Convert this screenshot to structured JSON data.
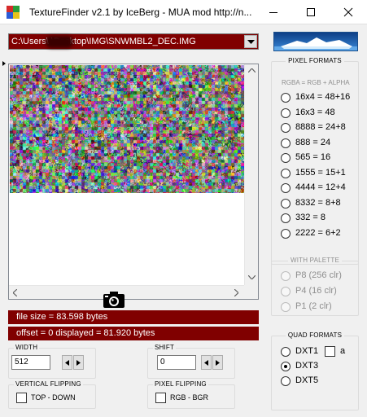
{
  "window": {
    "title": "TextureFinder v2.1 by IceBerg - MUA mod http://n..."
  },
  "file_path": "C:\\Users\\     \\Desktop\\IMG\\SNWMBL2_DEC.IMG",
  "info": {
    "file_size": "file size = 83.598 bytes",
    "offset_displayed": "offset = 0   displayed = 81.920 bytes"
  },
  "width_group": {
    "label": "WIDTH",
    "value": "512"
  },
  "shift_group": {
    "label": "SHIFT",
    "value": "0"
  },
  "vertical_flipping": {
    "label": "VERTICAL FLIPPING",
    "option": "TOP - DOWN",
    "checked": false
  },
  "pixel_flipping": {
    "label": "PIXEL FLIPPING",
    "option": "RGB  -  BGR",
    "checked": false
  },
  "pixel_formats": {
    "label": "PIXEL FORMATS",
    "subtitle": "RGBA = RGB + ALPHA",
    "options": [
      "16x4 = 48+16",
      "16x3 = 48",
      "8888 = 24+8",
      "888 = 24",
      "565 = 16",
      "1555 = 15+1",
      "4444 = 12+4",
      "8332 = 8+8",
      "332 = 8",
      "2222 = 6+2"
    ],
    "selected": null
  },
  "with_palette": {
    "label": "WITH PALETTE",
    "options": [
      "P8  (256 clr)",
      "P4  (16 clr)",
      "P1  (2 clr)"
    ],
    "enabled": false
  },
  "quad_formats": {
    "label": "QUAD FORMATS",
    "options": [
      "DXT1",
      "DXT3",
      "DXT5"
    ],
    "selected": "DXT3",
    "alpha_checkbox_label": "a",
    "alpha_checked": false
  },
  "icons": {
    "app": "app-icon",
    "minimize": "minimize-icon",
    "maximize": "maximize-icon",
    "close": "close-icon",
    "dropdown": "chevron-down-icon",
    "snapshot": "camera-icon",
    "logo": "iceberg-logo"
  },
  "colors": {
    "maroon": "#800000",
    "window_bg": "#f0f0f0",
    "logo_sky": "#1f5fa8"
  }
}
